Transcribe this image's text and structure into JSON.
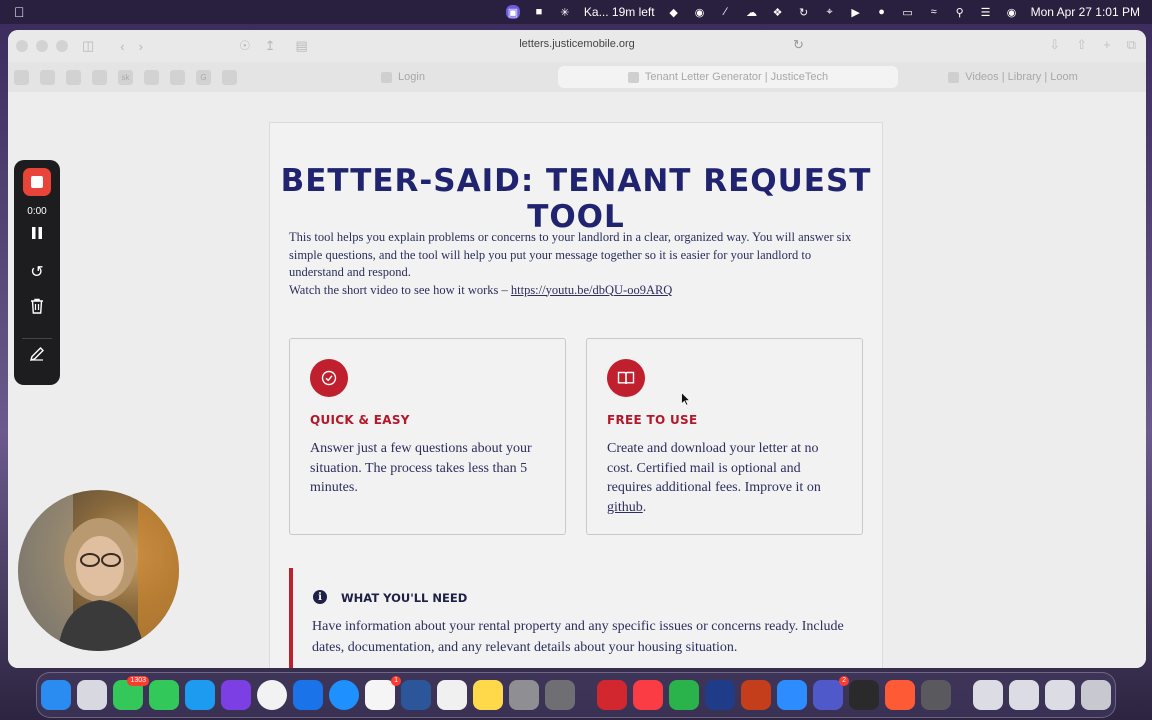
{
  "menubar": {
    "apple": "",
    "status_text": "Ka... 19m left",
    "datetime": "Mon Apr 27  1:01 PM"
  },
  "browser": {
    "url": "letters.justicemobile.org",
    "favorites": [
      "",
      "",
      "",
      "",
      "sk",
      "",
      "",
      "G",
      ""
    ],
    "tabs": [
      {
        "label": "Login",
        "active": false
      },
      {
        "label": "Tenant Letter Generator | JusticeTech",
        "active": true
      },
      {
        "label": "Videos | Library | Loom",
        "active": false
      }
    ]
  },
  "page": {
    "title": "BETTER-SAID: TENANT REQUEST TOOL",
    "intro": "This tool helps you explain problems or concerns to your landlord in a clear, organized way. You will answer six simple questions, and the tool will help you put your message together so it is easier for your landlord to understand and respond.",
    "video_prefix": "Watch the short video to see how it works – ",
    "video_link": "https://youtu.be/dbQU-oo9ARQ",
    "features": [
      {
        "icon": "check-circle-icon",
        "heading": "QUICK & EASY",
        "text": "Answer just a few questions about your situation. The process takes less than 5 minutes."
      },
      {
        "icon": "book-icon",
        "heading": "FREE TO USE",
        "text": "Create and download your letter at no cost. Certified mail is optional and requires additional fees. Improve it on ",
        "link": "github",
        "suffix": "."
      }
    ],
    "needs": {
      "heading": "WHAT YOU'LL NEED",
      "text": "Have information about your rental property and any specific issues or concerns ready. Include dates, documentation, and any relevant details about your housing situation."
    }
  },
  "recorder": {
    "time": "0:00"
  },
  "dock": {
    "badges": {
      "messages": "1303",
      "reminders": "1",
      "teams": "2"
    }
  },
  "colors": {
    "title": "#1f2370",
    "accent_red": "#c0202e",
    "body_text": "#2c2e5e"
  }
}
